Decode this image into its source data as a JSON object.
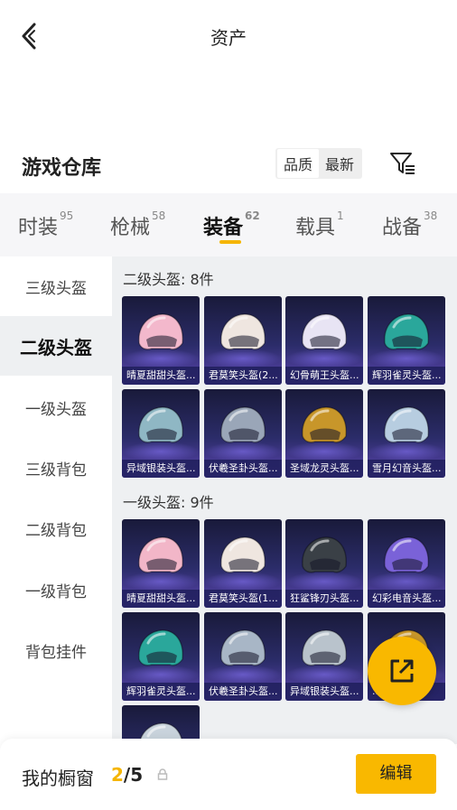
{
  "header": {
    "title": "资产"
  },
  "warehouse": {
    "title": "游戏仓库",
    "sort_options": [
      "品质",
      "最新"
    ],
    "active_sort": "品质"
  },
  "tabs": [
    {
      "label": "时装",
      "count": "95"
    },
    {
      "label": "枪械",
      "count": "58"
    },
    {
      "label": "装备",
      "count": "62"
    },
    {
      "label": "载具",
      "count": "1"
    },
    {
      "label": "战备",
      "count": "38"
    }
  ],
  "active_tab": "装备",
  "sidebar": {
    "items": [
      {
        "label": "三级头盔"
      },
      {
        "label": "二级头盔"
      },
      {
        "label": "一级头盔"
      },
      {
        "label": "三级背包"
      },
      {
        "label": "二级背包"
      },
      {
        "label": "一级背包"
      },
      {
        "label": "背包挂件"
      }
    ],
    "active": "二级头盔"
  },
  "groups": [
    {
      "title": "二级头盔: 8件",
      "items": [
        {
          "name": "晴夏甜甜头盔...",
          "color": "#f3b8cc"
        },
        {
          "name": "君莫笑头盔(2...",
          "color": "#efe6e0"
        },
        {
          "name": "幻骨萌王头盔...",
          "color": "#e8e4f4"
        },
        {
          "name": "辉羽雀灵头盔...",
          "color": "#2aa79b"
        },
        {
          "name": "异域银装头盔...",
          "color": "#8fb7c4"
        },
        {
          "name": "伏羲圣卦头盔...",
          "color": "#9aa6b8"
        },
        {
          "name": "圣域龙灵头盔...",
          "color": "#c8962a"
        },
        {
          "name": "雪月幻音头盔...",
          "color": "#b7cde0"
        }
      ]
    },
    {
      "title": "一级头盔: 9件",
      "items": [
        {
          "name": "晴夏甜甜头盔...",
          "color": "#f2b6c8"
        },
        {
          "name": "君莫笑头盔(1...",
          "color": "#efe6e0"
        },
        {
          "name": "狂鲨锋刃头盔...",
          "color": "#3a4046"
        },
        {
          "name": "幻彩电音头盔...",
          "color": "#7a62d8"
        },
        {
          "name": "辉羽雀灵头盔...",
          "color": "#2aa79b"
        },
        {
          "name": "伏羲圣卦头盔...",
          "color": "#a8b6c6"
        },
        {
          "name": "异域银装头盔...",
          "color": "#b9c3cc"
        },
        {
          "name": "...",
          "color": "#c8962a"
        },
        {
          "name": "",
          "color": "#c9d3dc"
        }
      ]
    }
  ],
  "showcase": {
    "label": "我的橱窗",
    "current": "2",
    "total": "/5",
    "edit_label": "编辑"
  }
}
